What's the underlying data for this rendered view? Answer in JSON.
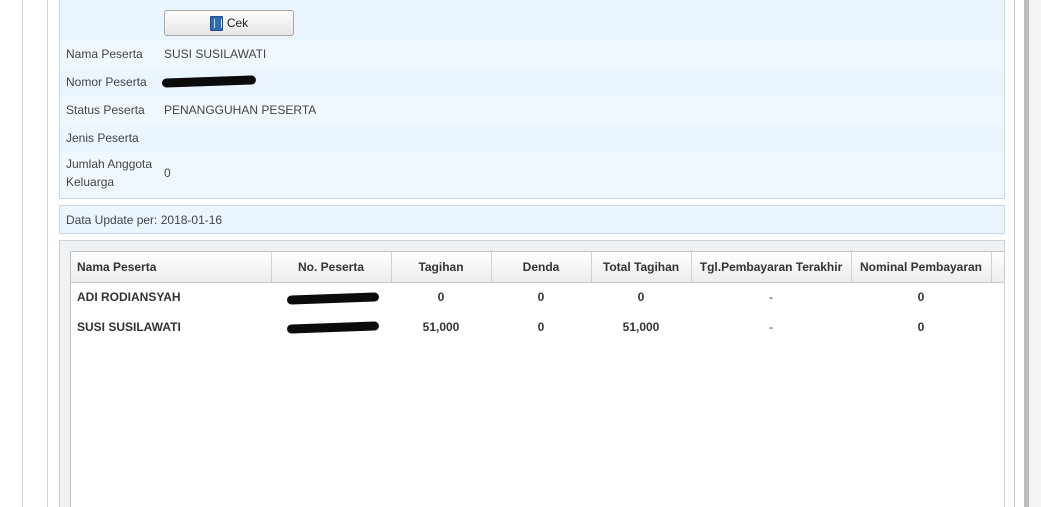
{
  "form": {
    "cek_button_label": "Cek",
    "fields": [
      {
        "label": "Nama Peserta",
        "value": "SUSI SUSILAWATI"
      },
      {
        "label": "Nomor Peserta",
        "value": ""
      },
      {
        "label": "Status Peserta",
        "value": "PENANGGUHAN PESERTA"
      },
      {
        "label": "Jenis Peserta",
        "value": ""
      },
      {
        "label_line1": "Jumlah Anggota",
        "label_line2": "Keluarga",
        "value": "0"
      }
    ]
  },
  "update_text": "Data Update per: 2018-01-16",
  "table": {
    "headers": [
      "Nama Peserta",
      "No. Peserta",
      "Tagihan",
      "Denda",
      "Total Tagihan",
      "Tgl.Pembayaran Terakhir",
      "Nominal Pembayaran"
    ],
    "rows": [
      {
        "nama": "ADI RODIANSYAH",
        "no_peserta": "",
        "tagihan": "0",
        "denda": "0",
        "total": "0",
        "tgl": "-",
        "nominal": "0"
      },
      {
        "nama": "SUSI SUSILAWATI",
        "no_peserta": "",
        "tagihan": "51,000",
        "denda": "0",
        "total": "51,000",
        "tgl": "-",
        "nominal": "0"
      }
    ]
  }
}
